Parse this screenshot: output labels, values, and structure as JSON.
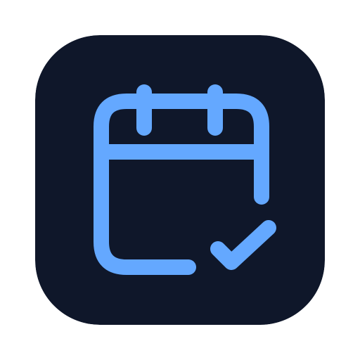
{
  "app_icon": {
    "icon": "calendar-check-icon",
    "colors": {
      "tile_background": "#0f172a",
      "glyph_stroke": "#64a8ff"
    }
  }
}
